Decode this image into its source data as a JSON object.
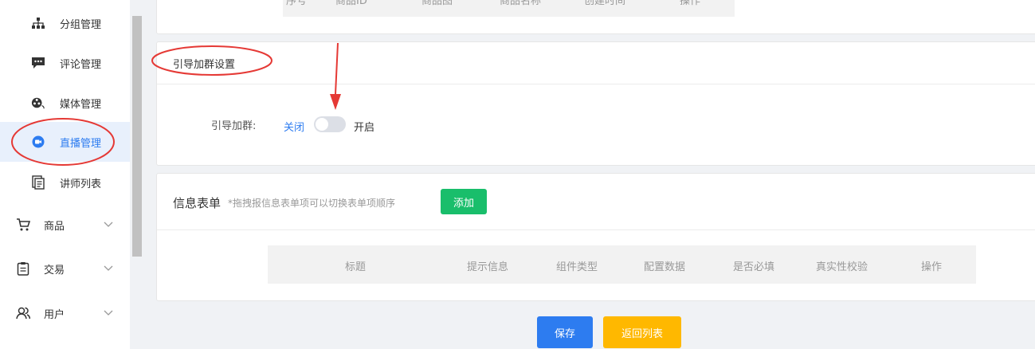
{
  "sidebar": {
    "items": [
      {
        "label": "分组管理",
        "icon": "sitemap-icon"
      },
      {
        "label": "评论管理",
        "icon": "comment-icon"
      },
      {
        "label": "媒体管理",
        "icon": "media-icon"
      },
      {
        "label": "直播管理",
        "icon": "live-video-icon",
        "active": true
      },
      {
        "label": "讲师列表",
        "icon": "list-icon"
      }
    ],
    "groups": [
      {
        "label": "商品",
        "icon": "cart-icon"
      },
      {
        "label": "交易",
        "icon": "clipboard-icon"
      },
      {
        "label": "用户",
        "icon": "users-icon"
      }
    ]
  },
  "top_table": {
    "headers": [
      "序号",
      "商品ID",
      "商品图",
      "商品名称",
      "创建时间",
      "操作"
    ]
  },
  "guide_section": {
    "title": "引导加群设置",
    "field_label": "引导加群:",
    "toggle_off_label": "关闭",
    "toggle_on_label": "开启",
    "toggle_state": "off"
  },
  "info_form": {
    "title": "信息表单",
    "hint": "*拖拽报信息表单项可以切换表单项顺序",
    "add_button": "添加",
    "headers": [
      "标题",
      "提示信息",
      "组件类型",
      "配置数据",
      "是否必填",
      "真实性校验",
      "操作"
    ]
  },
  "footer": {
    "save_button": "保存",
    "back_button": "返回列表"
  },
  "colors": {
    "primary": "#2d7cf0",
    "success": "#19be6b",
    "warning": "#ffb800",
    "annotation": "#e53935"
  }
}
